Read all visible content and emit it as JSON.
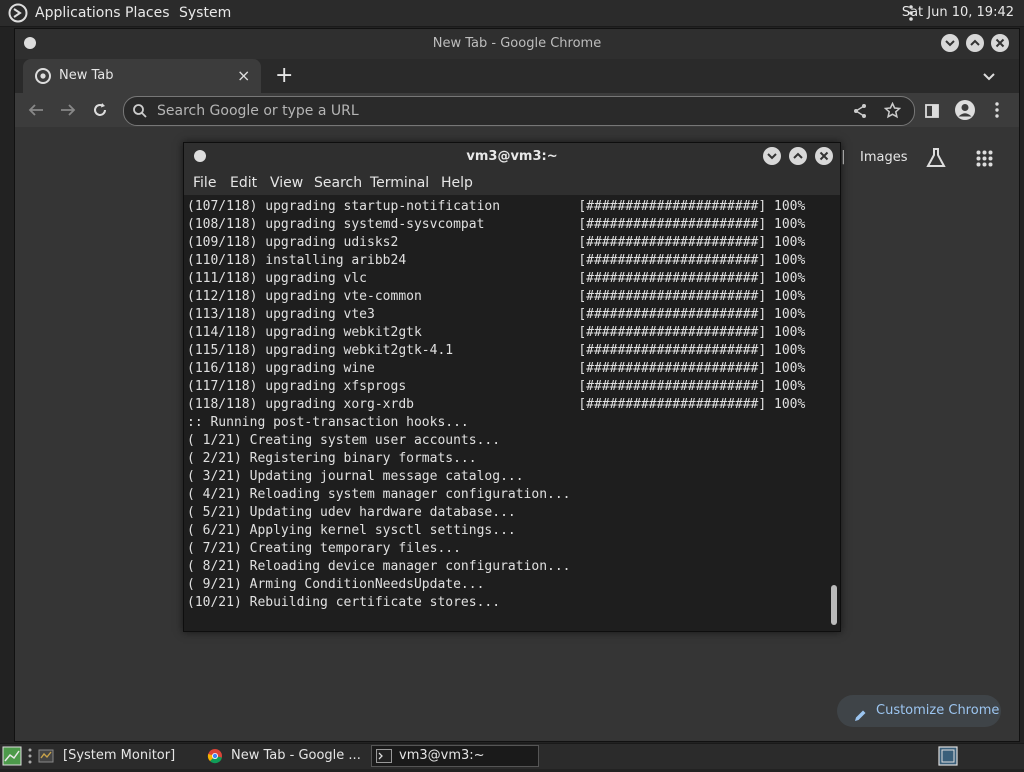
{
  "top_panel": {
    "menus": [
      "Applications",
      "Places",
      "System"
    ],
    "clock": "Sat Jun 10, 19:42"
  },
  "chrome": {
    "window_title": "New Tab - Google Chrome",
    "tab": {
      "label": "New Tab",
      "close": "×"
    },
    "new_tab": "+",
    "tab_menu": "⌄",
    "omnibox_placeholder": "Search Google or type a URL",
    "ntp": {
      "sep": "|",
      "images_link": "Images",
      "customize_label": "Customize Chrome"
    }
  },
  "terminal": {
    "title": "vm3@vm3:~",
    "menus": [
      "File",
      "Edit",
      "View",
      "Search",
      "Terminal",
      "Help"
    ],
    "lines": [
      "(107/118) upgrading startup-notification          [######################] 100%",
      "(108/118) upgrading systemd-sysvcompat            [######################] 100%",
      "(109/118) upgrading udisks2                       [######################] 100%",
      "(110/118) installing aribb24                      [######################] 100%",
      "(111/118) upgrading vlc                           [######################] 100%",
      "(112/118) upgrading vte-common                    [######################] 100%",
      "(113/118) upgrading vte3                          [######################] 100%",
      "(114/118) upgrading webkit2gtk                    [######################] 100%",
      "(115/118) upgrading webkit2gtk-4.1                [######################] 100%",
      "(116/118) upgrading wine                          [######################] 100%",
      "(117/118) upgrading xfsprogs                      [######################] 100%",
      "(118/118) upgrading xorg-xrdb                     [######################] 100%",
      ":: Running post-transaction hooks...",
      "( 1/21) Creating system user accounts...",
      "( 2/21) Registering binary formats...",
      "( 3/21) Updating journal message catalog...",
      "( 4/21) Reloading system manager configuration...",
      "( 5/21) Updating udev hardware database...",
      "( 6/21) Applying kernel sysctl settings...",
      "( 7/21) Creating temporary files...",
      "( 8/21) Reloading device manager configuration...",
      "( 9/21) Arming ConditionNeedsUpdate...",
      "(10/21) Rebuilding certificate stores..."
    ]
  },
  "taskbar": {
    "tasks": [
      "[System Monitor]",
      "New Tab - Google ...",
      "vm3@vm3:~"
    ]
  },
  "colors": {
    "accent": "#9cc5f0",
    "terminal_bg": "#1e1e1e",
    "panel_bg": "#2b2b2b"
  }
}
